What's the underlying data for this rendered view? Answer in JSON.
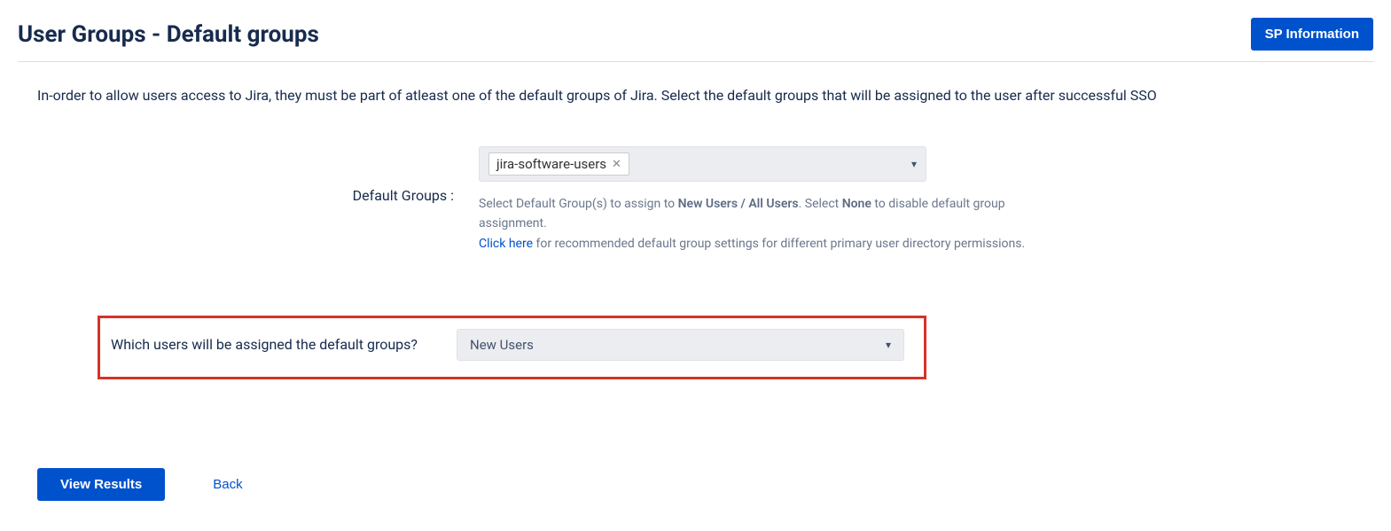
{
  "header": {
    "title": "User Groups - Default groups",
    "sp_info_button": "SP Information"
  },
  "intro": "In-order to allow users access to Jira, they must be part of atleast one of the default groups of Jira. Select the default groups that will be assigned to the user after successful SSO",
  "default_groups": {
    "label": "Default Groups :",
    "selected_chip": "jira-software-users",
    "helper_pre": "Select Default Group(s) to assign to ",
    "helper_bold1": "New Users / All Users",
    "helper_mid": ". Select ",
    "helper_bold2": "None",
    "helper_post": " to disable default group assignment.",
    "click_here": "Click here",
    "click_here_rest": " for recommended default group settings for different primary user directory permissions."
  },
  "assign_section": {
    "label": "Which users will be assigned the default groups?",
    "selected": "New Users"
  },
  "footer": {
    "view_results": "View Results",
    "back": "Back"
  }
}
